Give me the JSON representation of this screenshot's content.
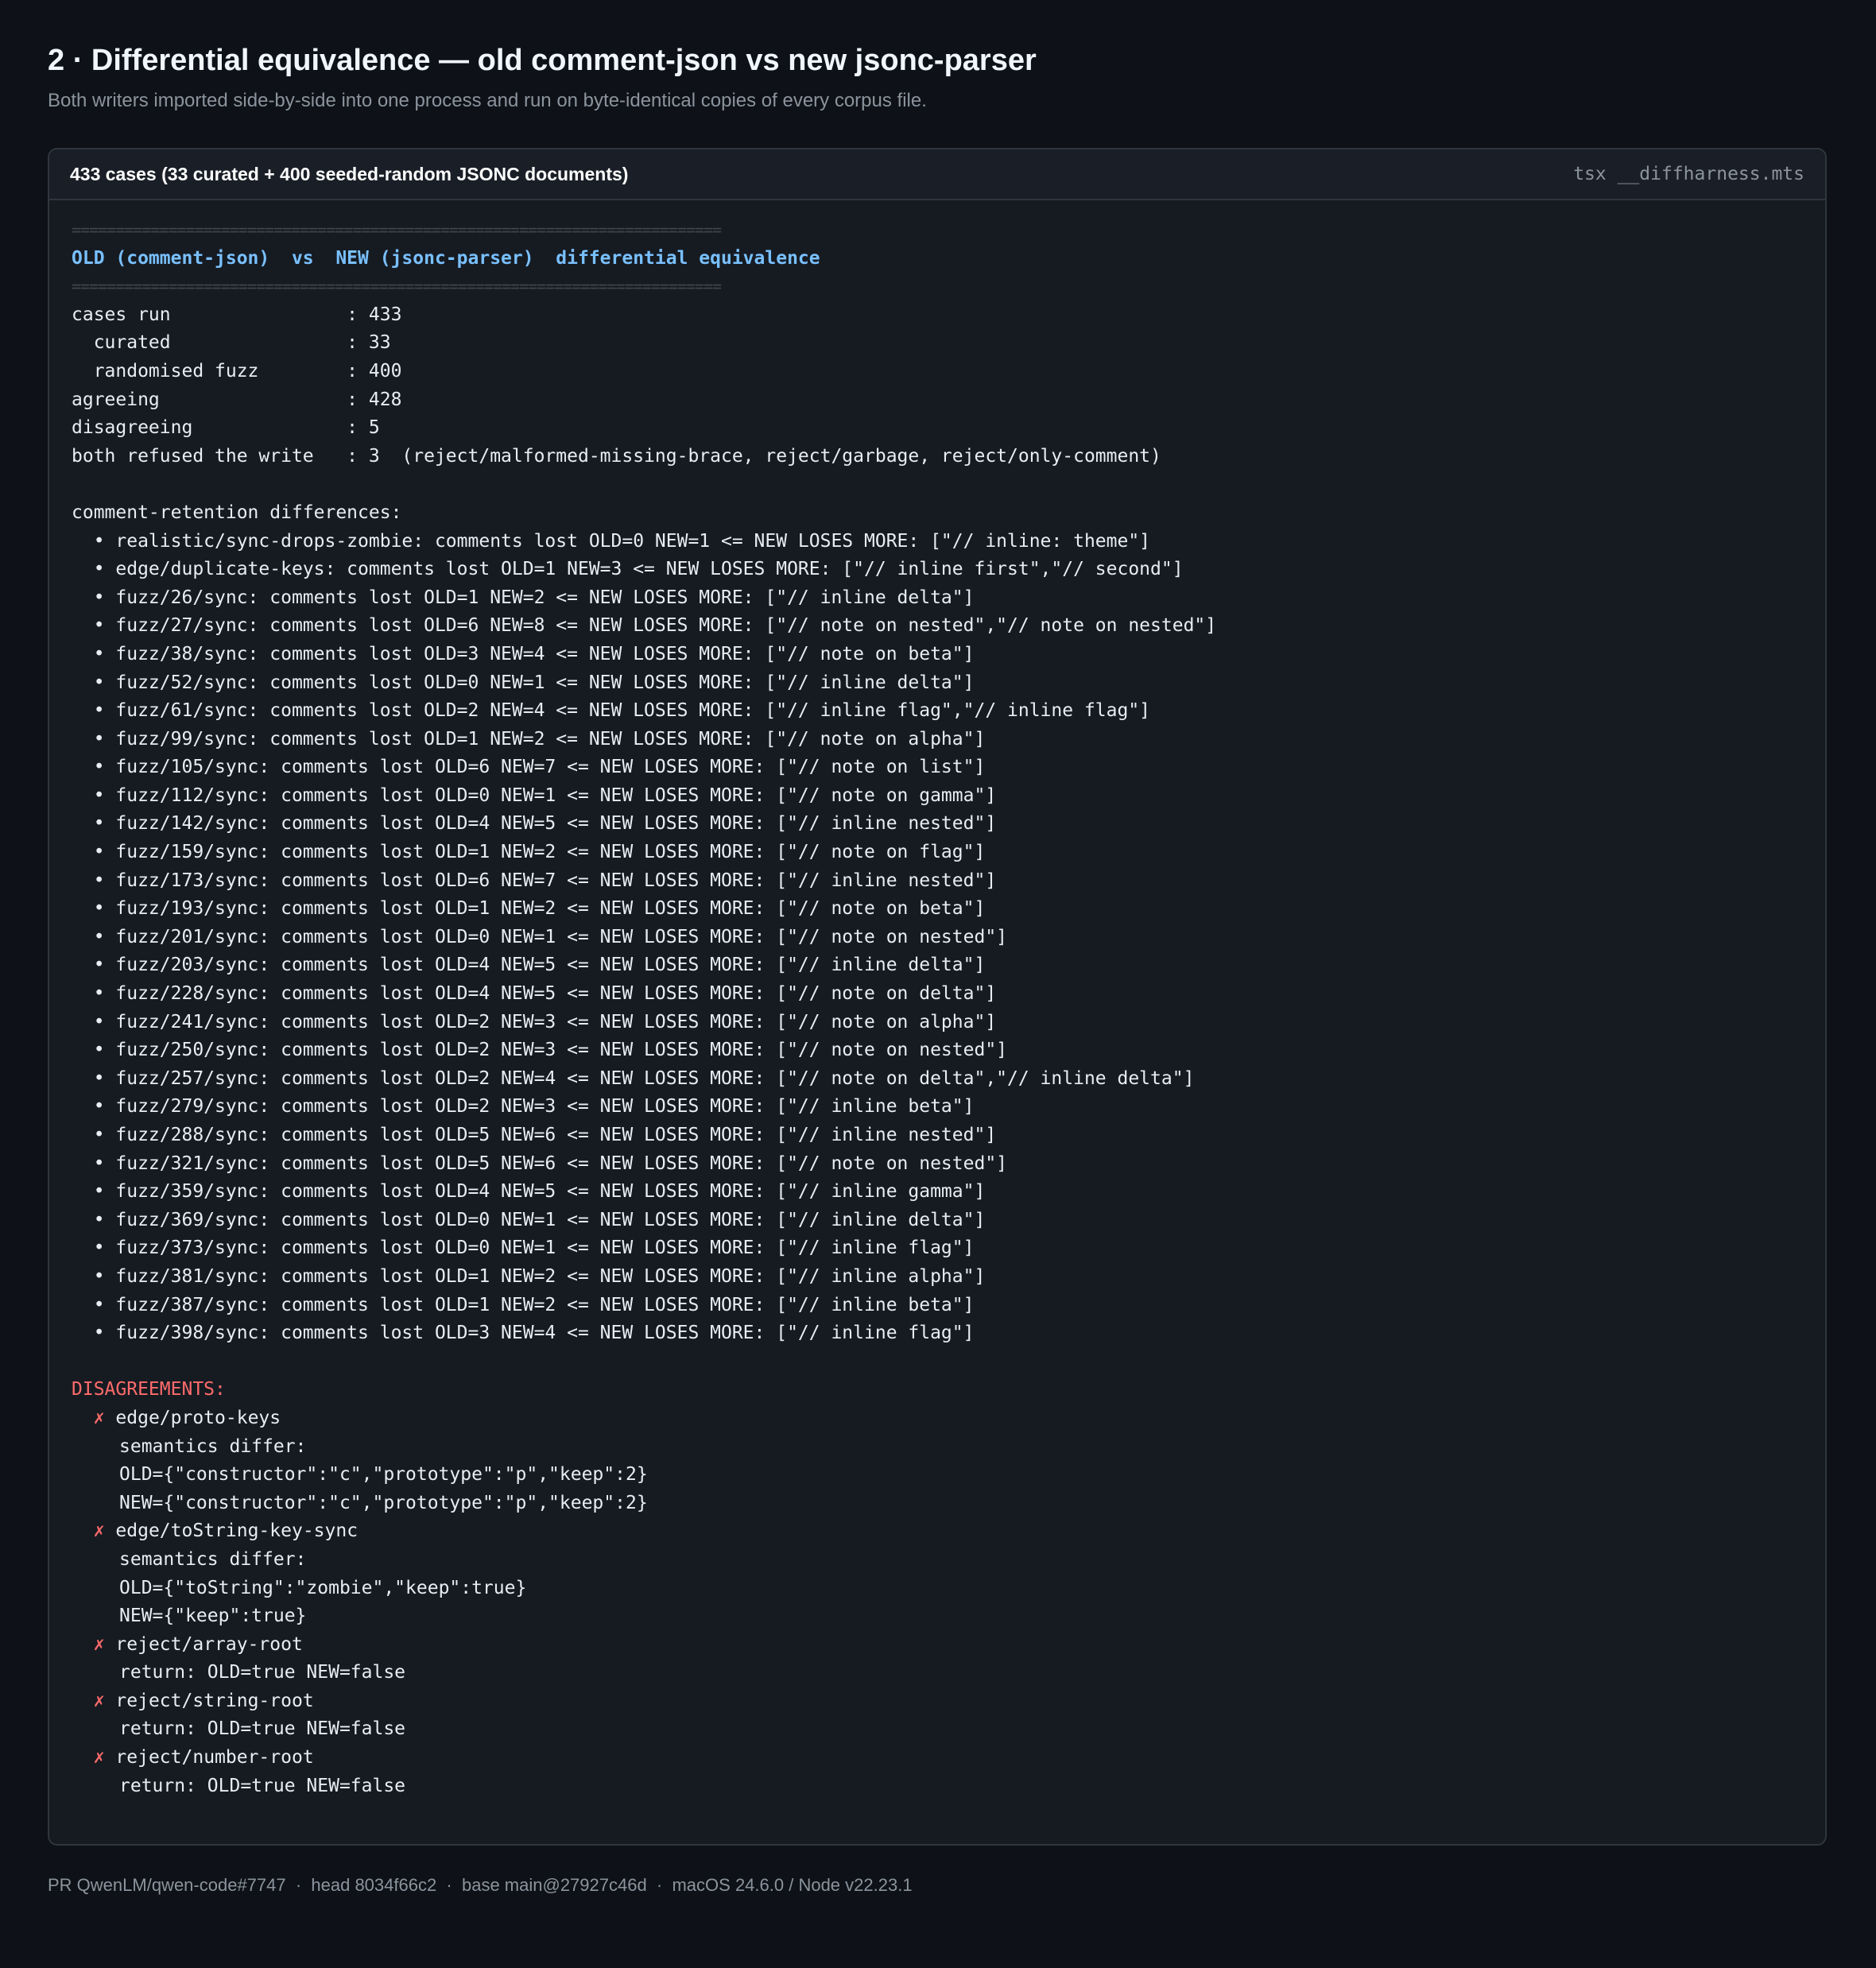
{
  "section": {
    "title": "2 · Differential equivalence — old comment-json vs new jsonc-parser",
    "subtitle": "Both writers imported side-by-side into one process and run on byte-identical copies of every corpus file."
  },
  "panel": {
    "title": "433 cases (33 curated + 400 seeded-random JSONC documents)",
    "command": "tsx __diffharness.mts"
  },
  "terminal": {
    "rule": "==========================================================================",
    "heading": "OLD (comment-json)  vs  NEW (jsonc-parser)  differential equivalence",
    "stats": [
      "cases run                : 433",
      "  curated                : 33",
      "  randomised fuzz        : 400",
      "agreeing                 : 428",
      "disagreeing              : 5",
      "both refused the write   : 3  (reject/malformed-missing-brace, reject/garbage, reject/only-comment)"
    ],
    "retention_heading": "comment-retention differences:",
    "retention": [
      "  • realistic/sync-drops-zombie: comments lost OLD=0 NEW=1 <= NEW LOSES MORE: [\"// inline: theme\"]",
      "  • edge/duplicate-keys: comments lost OLD=1 NEW=3 <= NEW LOSES MORE: [\"// inline first\",\"// second\"]",
      "  • fuzz/26/sync: comments lost OLD=1 NEW=2 <= NEW LOSES MORE: [\"// inline delta\"]",
      "  • fuzz/27/sync: comments lost OLD=6 NEW=8 <= NEW LOSES MORE: [\"// note on nested\",\"// note on nested\"]",
      "  • fuzz/38/sync: comments lost OLD=3 NEW=4 <= NEW LOSES MORE: [\"// note on beta\"]",
      "  • fuzz/52/sync: comments lost OLD=0 NEW=1 <= NEW LOSES MORE: [\"// inline delta\"]",
      "  • fuzz/61/sync: comments lost OLD=2 NEW=4 <= NEW LOSES MORE: [\"// inline flag\",\"// inline flag\"]",
      "  • fuzz/99/sync: comments lost OLD=1 NEW=2 <= NEW LOSES MORE: [\"// note on alpha\"]",
      "  • fuzz/105/sync: comments lost OLD=6 NEW=7 <= NEW LOSES MORE: [\"// note on list\"]",
      "  • fuzz/112/sync: comments lost OLD=0 NEW=1 <= NEW LOSES MORE: [\"// note on gamma\"]",
      "  • fuzz/142/sync: comments lost OLD=4 NEW=5 <= NEW LOSES MORE: [\"// inline nested\"]",
      "  • fuzz/159/sync: comments lost OLD=1 NEW=2 <= NEW LOSES MORE: [\"// note on flag\"]",
      "  • fuzz/173/sync: comments lost OLD=6 NEW=7 <= NEW LOSES MORE: [\"// inline nested\"]",
      "  • fuzz/193/sync: comments lost OLD=1 NEW=2 <= NEW LOSES MORE: [\"// note on beta\"]",
      "  • fuzz/201/sync: comments lost OLD=0 NEW=1 <= NEW LOSES MORE: [\"// note on nested\"]",
      "  • fuzz/203/sync: comments lost OLD=4 NEW=5 <= NEW LOSES MORE: [\"// inline delta\"]",
      "  • fuzz/228/sync: comments lost OLD=4 NEW=5 <= NEW LOSES MORE: [\"// note on delta\"]",
      "  • fuzz/241/sync: comments lost OLD=2 NEW=3 <= NEW LOSES MORE: [\"// note on alpha\"]",
      "  • fuzz/250/sync: comments lost OLD=2 NEW=3 <= NEW LOSES MORE: [\"// note on nested\"]",
      "  • fuzz/257/sync: comments lost OLD=2 NEW=4 <= NEW LOSES MORE: [\"// note on delta\",\"// inline delta\"]",
      "  • fuzz/279/sync: comments lost OLD=2 NEW=3 <= NEW LOSES MORE: [\"// inline beta\"]",
      "  • fuzz/288/sync: comments lost OLD=5 NEW=6 <= NEW LOSES MORE: [\"// inline nested\"]",
      "  • fuzz/321/sync: comments lost OLD=5 NEW=6 <= NEW LOSES MORE: [\"// note on nested\"]",
      "  • fuzz/359/sync: comments lost OLD=4 NEW=5 <= NEW LOSES MORE: [\"// inline gamma\"]",
      "  • fuzz/369/sync: comments lost OLD=0 NEW=1 <= NEW LOSES MORE: [\"// inline delta\"]",
      "  • fuzz/373/sync: comments lost OLD=0 NEW=1 <= NEW LOSES MORE: [\"// inline flag\"]",
      "  • fuzz/381/sync: comments lost OLD=1 NEW=2 <= NEW LOSES MORE: [\"// inline alpha\"]",
      "  • fuzz/387/sync: comments lost OLD=1 NEW=2 <= NEW LOSES MORE: [\"// inline beta\"]",
      "  • fuzz/398/sync: comments lost OLD=3 NEW=4 <= NEW LOSES MORE: [\"// inline flag\"]"
    ],
    "disagreements_heading": "DISAGREEMENTS:",
    "cross_mark": "✗",
    "disagreements": [
      {
        "name": "edge/proto-keys",
        "details": [
          "semantics differ:",
          "OLD={\"constructor\":\"c\",\"prototype\":\"p\",\"keep\":2}",
          "NEW={\"constructor\":\"c\",\"prototype\":\"p\",\"keep\":2}"
        ]
      },
      {
        "name": "edge/toString-key-sync",
        "details": [
          "semantics differ:",
          "OLD={\"toString\":\"zombie\",\"keep\":true}",
          "NEW={\"keep\":true}"
        ]
      },
      {
        "name": "reject/array-root",
        "details": [
          "return: OLD=true NEW=false"
        ]
      },
      {
        "name": "reject/string-root",
        "details": [
          "return: OLD=true NEW=false"
        ]
      },
      {
        "name": "reject/number-root",
        "details": [
          "return: OLD=true NEW=false"
        ]
      }
    ]
  },
  "footer": "PR QwenLM/qwen-code#7747  ·  head 8034f66c2  ·  base main@27927c46d  ·  macOS 24.6.0 / Node v22.23.1",
  "colors": {
    "background": "#0e1117",
    "panel": "#161b22",
    "heading": "#79c0ff",
    "error": "#ff6b6b"
  }
}
